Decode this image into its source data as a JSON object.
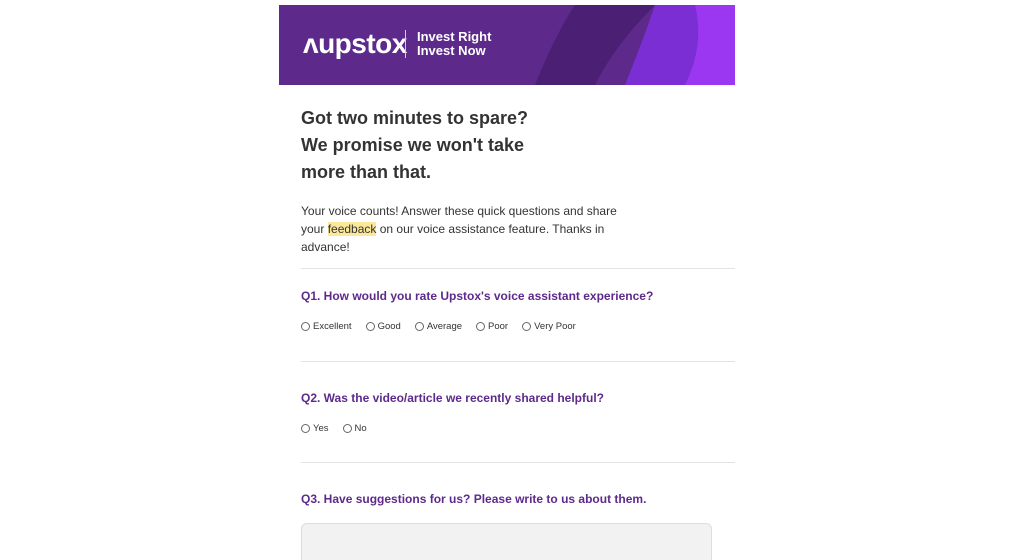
{
  "banner": {
    "logo": "ʌupstox",
    "tagline_line1": "Invest Right",
    "tagline_line2": "Invest Now",
    "bg_color": "#5d2a8c",
    "accent_color": "#9b37f0"
  },
  "intro": {
    "headline": "Got two minutes to spare? We promise we won't take more than that.",
    "body_before": "Your voice counts! Answer these quick questions and share your ",
    "body_highlight": "feedback",
    "body_after": " on our voice assistance feature. Thanks in advance!"
  },
  "q1": {
    "text": "Q1. How would you rate Upstox's voice assistant experience?",
    "options": [
      "Excellent",
      "Good",
      "Average",
      "Poor",
      "Very Poor"
    ]
  },
  "q2": {
    "text": "Q2. Was the video/article we recently shared helpful?",
    "options": [
      "Yes",
      "No"
    ]
  },
  "q3": {
    "text": "Q3. Have suggestions for us? Please write to us about them."
  },
  "colors": {
    "question": "#5d2a8c",
    "highlight": "#fbe89a"
  }
}
